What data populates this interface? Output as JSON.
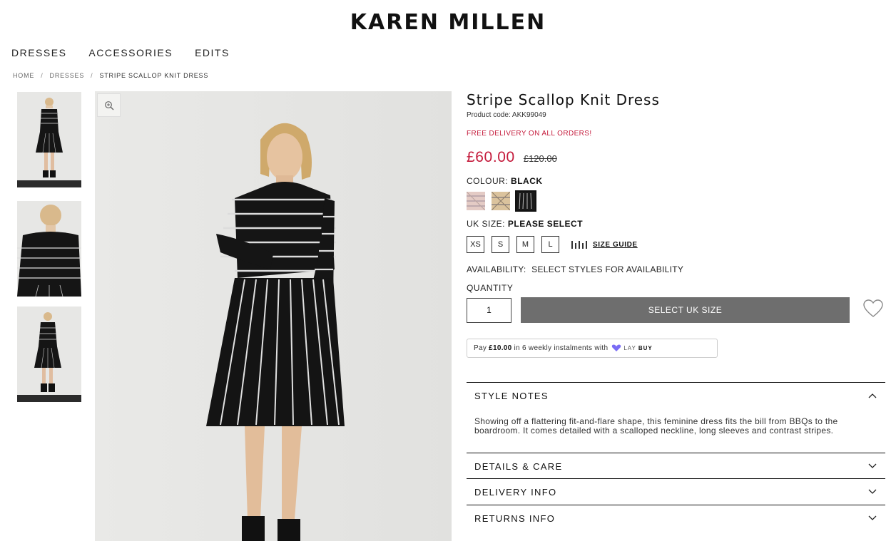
{
  "brand": "KAREN MILLEN",
  "nav": [
    "DRESSES",
    "ACCESSORIES",
    "EDITS"
  ],
  "breadcrumb": {
    "home": "HOME",
    "category": "DRESSES",
    "current": "STRIPE SCALLOP KNIT DRESS",
    "separator": "/"
  },
  "product": {
    "title": "Stripe Scallop Knit Dress",
    "code": "Product code: AKK99049",
    "promo": "FREE DELIVERY ON ALL ORDERS!",
    "price": "£60.00",
    "was_price": "£120.00",
    "colour_label": "COLOUR:",
    "colour_value": "BLACK",
    "swatches": [
      {
        "name": "pink-stripe",
        "color": "#e2c7c1",
        "selected": false
      },
      {
        "name": "camel-stripe",
        "color": "#dcc4a0",
        "selected": false
      },
      {
        "name": "black-stripe",
        "color": "#1a1a1a",
        "selected": true
      }
    ],
    "size_label": "UK SIZE:",
    "size_value": "PLEASE SELECT",
    "sizes": [
      "XS",
      "S",
      "M",
      "L"
    ],
    "size_guide": "SIZE GUIDE",
    "availability_label": "AVAILABILITY:",
    "availability_value": "SELECT STYLES FOR AVAILABILITY",
    "quantity_label": "QUANTITY",
    "quantity": "1",
    "cta": "SELECT UK SIZE",
    "laybuy": {
      "pre": "Pay",
      "amount": "£10.00",
      "post": "in 6 weekly instalments with",
      "logo_a": "LAY",
      "logo_b": "BUY"
    }
  },
  "accordions": [
    {
      "title": "STYLE NOTES",
      "expanded": true,
      "body": "Showing off a flattering fit-and-flare shape, this feminine dress fits the bill from BBQs to the boardroom. It comes detailed with a scalloped neckline, long sleeves and contrast stripes."
    },
    {
      "title": "DETAILS & CARE",
      "expanded": false
    },
    {
      "title": "DELIVERY INFO",
      "expanded": false
    },
    {
      "title": "RETURNS INFO",
      "expanded": false
    }
  ],
  "colors": {
    "sale": "#c41a3b",
    "cta_bg": "#6e6e6e",
    "laybuy_purple": "#7a6cf5"
  }
}
